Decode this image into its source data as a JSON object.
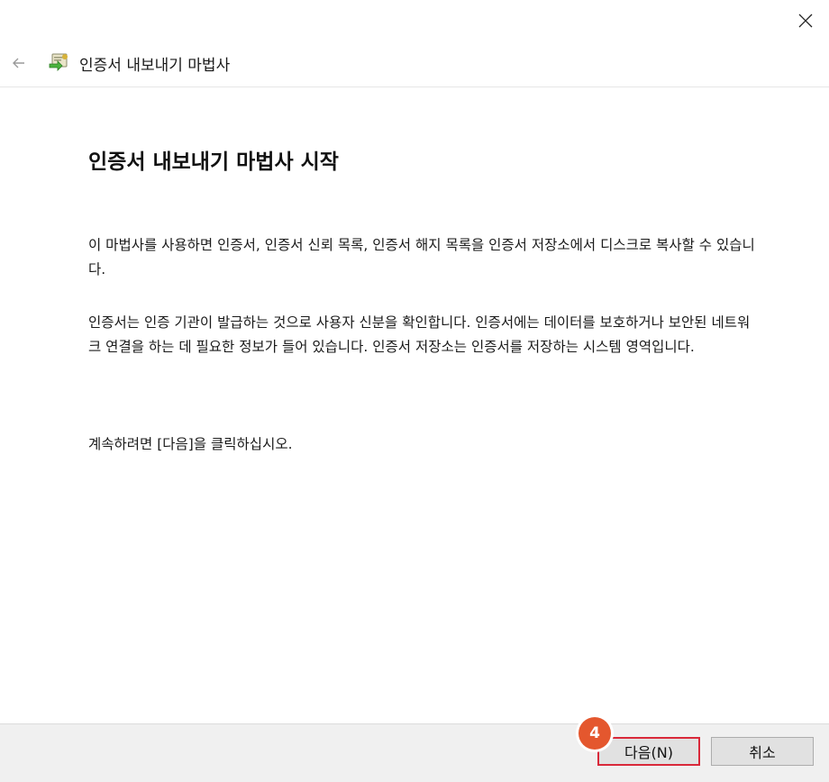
{
  "window": {
    "close_icon": "close-icon"
  },
  "titlebar": {
    "back_icon": "back-arrow-icon",
    "app_icon": "certificate-export-icon",
    "title": "인증서 내보내기 마법사"
  },
  "main": {
    "heading": "인증서 내보내기 마법사 시작",
    "paragraph1": "이 마법사를 사용하면 인증서, 인증서 신뢰 목록, 인증서 해지 목록을 인증서 저장소에서 디스크로 복사할 수 있습니다.",
    "paragraph2": "인증서는 인증 기관이 발급하는 것으로 사용자 신분을 확인합니다. 인증서에는 데이터를 보호하거나 보안된 네트워크 연결을 하는 데 필요한 정보가 들어 있습니다. 인증서 저장소는 인증서를 저장하는 시스템 영역입니다.",
    "paragraph3": "계속하려면 [다음]을 클릭하십시오."
  },
  "footer": {
    "next_label": "다음(N)",
    "cancel_label": "취소",
    "step_badge": "4"
  },
  "colors": {
    "highlight": "#d9293a",
    "badge": "#e4572e"
  }
}
